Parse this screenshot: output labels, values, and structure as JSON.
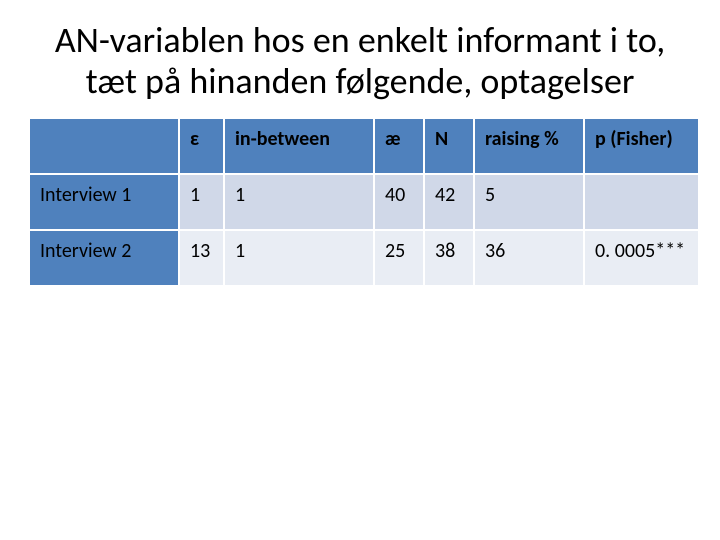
{
  "title": "AN-variablen hos en enkelt informant i to, tæt på hinanden følgende, optagelser",
  "columns": [
    "",
    "ε",
    "in-between",
    "æ",
    "N",
    "raising %",
    "p (Fisher)"
  ],
  "rows": [
    {
      "label": "Interview 1",
      "cells": [
        "1",
        "1",
        "40",
        "42",
        "5",
        ""
      ]
    },
    {
      "label": "Interview 2",
      "cells": [
        "13",
        "1",
        "25",
        "38",
        "36",
        "0. 0005***"
      ]
    }
  ],
  "chart_data": {
    "type": "table",
    "title": "AN-variablen hos en enkelt informant i to, tæt på hinanden følgende, optagelser",
    "columns": [
      "ε",
      "in-between",
      "æ",
      "N",
      "raising %",
      "p (Fisher)"
    ],
    "rows": [
      {
        "label": "Interview 1",
        "values": [
          1,
          1,
          40,
          42,
          5,
          null
        ]
      },
      {
        "label": "Interview 2",
        "values": [
          13,
          1,
          25,
          38,
          36,
          "0.0005***"
        ]
      }
    ]
  }
}
